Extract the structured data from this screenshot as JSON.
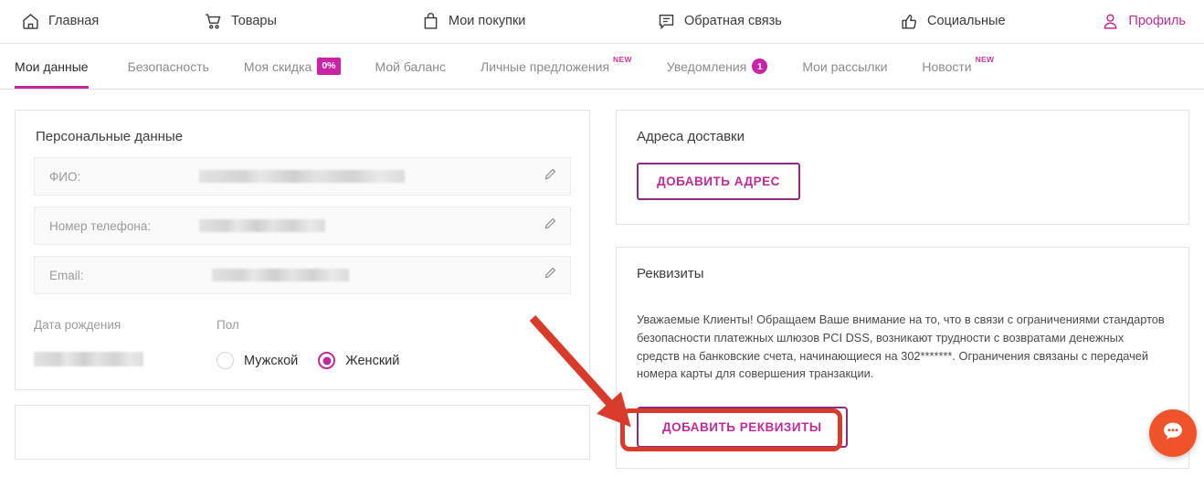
{
  "colors": {
    "accent": "#c2299a",
    "badge": "#cc22a5",
    "annotation_red": "#d93b2b",
    "chat_orange": "#f0522a"
  },
  "top_nav": {
    "items": [
      {
        "label": "Главная",
        "icon": "home-icon"
      },
      {
        "label": "Товары",
        "icon": "cart-icon"
      },
      {
        "label": "Мои покупки",
        "icon": "bag-icon"
      },
      {
        "label": "Обратная связь",
        "icon": "chat-icon"
      },
      {
        "label": "Социальные",
        "icon": "thumbs-up-icon"
      },
      {
        "label": "Профиль",
        "icon": "user-icon"
      }
    ]
  },
  "tabs": [
    {
      "label": "Мои данные",
      "active": true
    },
    {
      "label": "Безопасность",
      "active": false
    },
    {
      "label": "Моя скидка",
      "active": false,
      "badge": "0%",
      "badge_type": "square"
    },
    {
      "label": "Мой баланс",
      "active": false
    },
    {
      "label": "Личные предложения",
      "active": false,
      "badge": "NEW",
      "badge_type": "new"
    },
    {
      "label": "Уведомления",
      "active": false,
      "badge": "1",
      "badge_type": "round"
    },
    {
      "label": "Мои рассылки",
      "active": false
    },
    {
      "label": "Новости",
      "active": false,
      "badge": "NEW",
      "badge_type": "new"
    }
  ],
  "personal": {
    "title": "Персональные данные",
    "fields": [
      {
        "label": "ФИО:",
        "value": "",
        "redacted": true,
        "edit_icon": "pencil-icon"
      },
      {
        "label": "Номер телефона:",
        "value": "",
        "redacted": true,
        "edit_icon": "pencil-icon"
      },
      {
        "label": "Email:",
        "value": "",
        "redacted": true,
        "edit_icon": "pencil-icon"
      }
    ],
    "dob_label": "Дата рождения",
    "dob_value": "",
    "gender_label": "Пол",
    "gender_options": [
      {
        "label": "Мужской",
        "selected": false
      },
      {
        "label": "Женский",
        "selected": true
      }
    ]
  },
  "addresses": {
    "title": "Адреса доставки",
    "add_button": "ДОБАВИТЬ АДРЕС"
  },
  "requisites": {
    "title": "Реквизиты",
    "notice": "Уважаемые Клиенты! Обращаем Ваше внимание на то, что в связи с ограничениями стандартов безопасности платежных шлюзов PCI DSS, возникают трудности с возвратами денежных средств на банковские счета, начинающиеся на 302*******. Ограничения связаны с передачей номера карты для совершения транзакции.",
    "add_button": "ДОБАВИТЬ РЕКВИЗИТЫ"
  },
  "chat_widget": {
    "icon": "chat-bubble-icon"
  }
}
